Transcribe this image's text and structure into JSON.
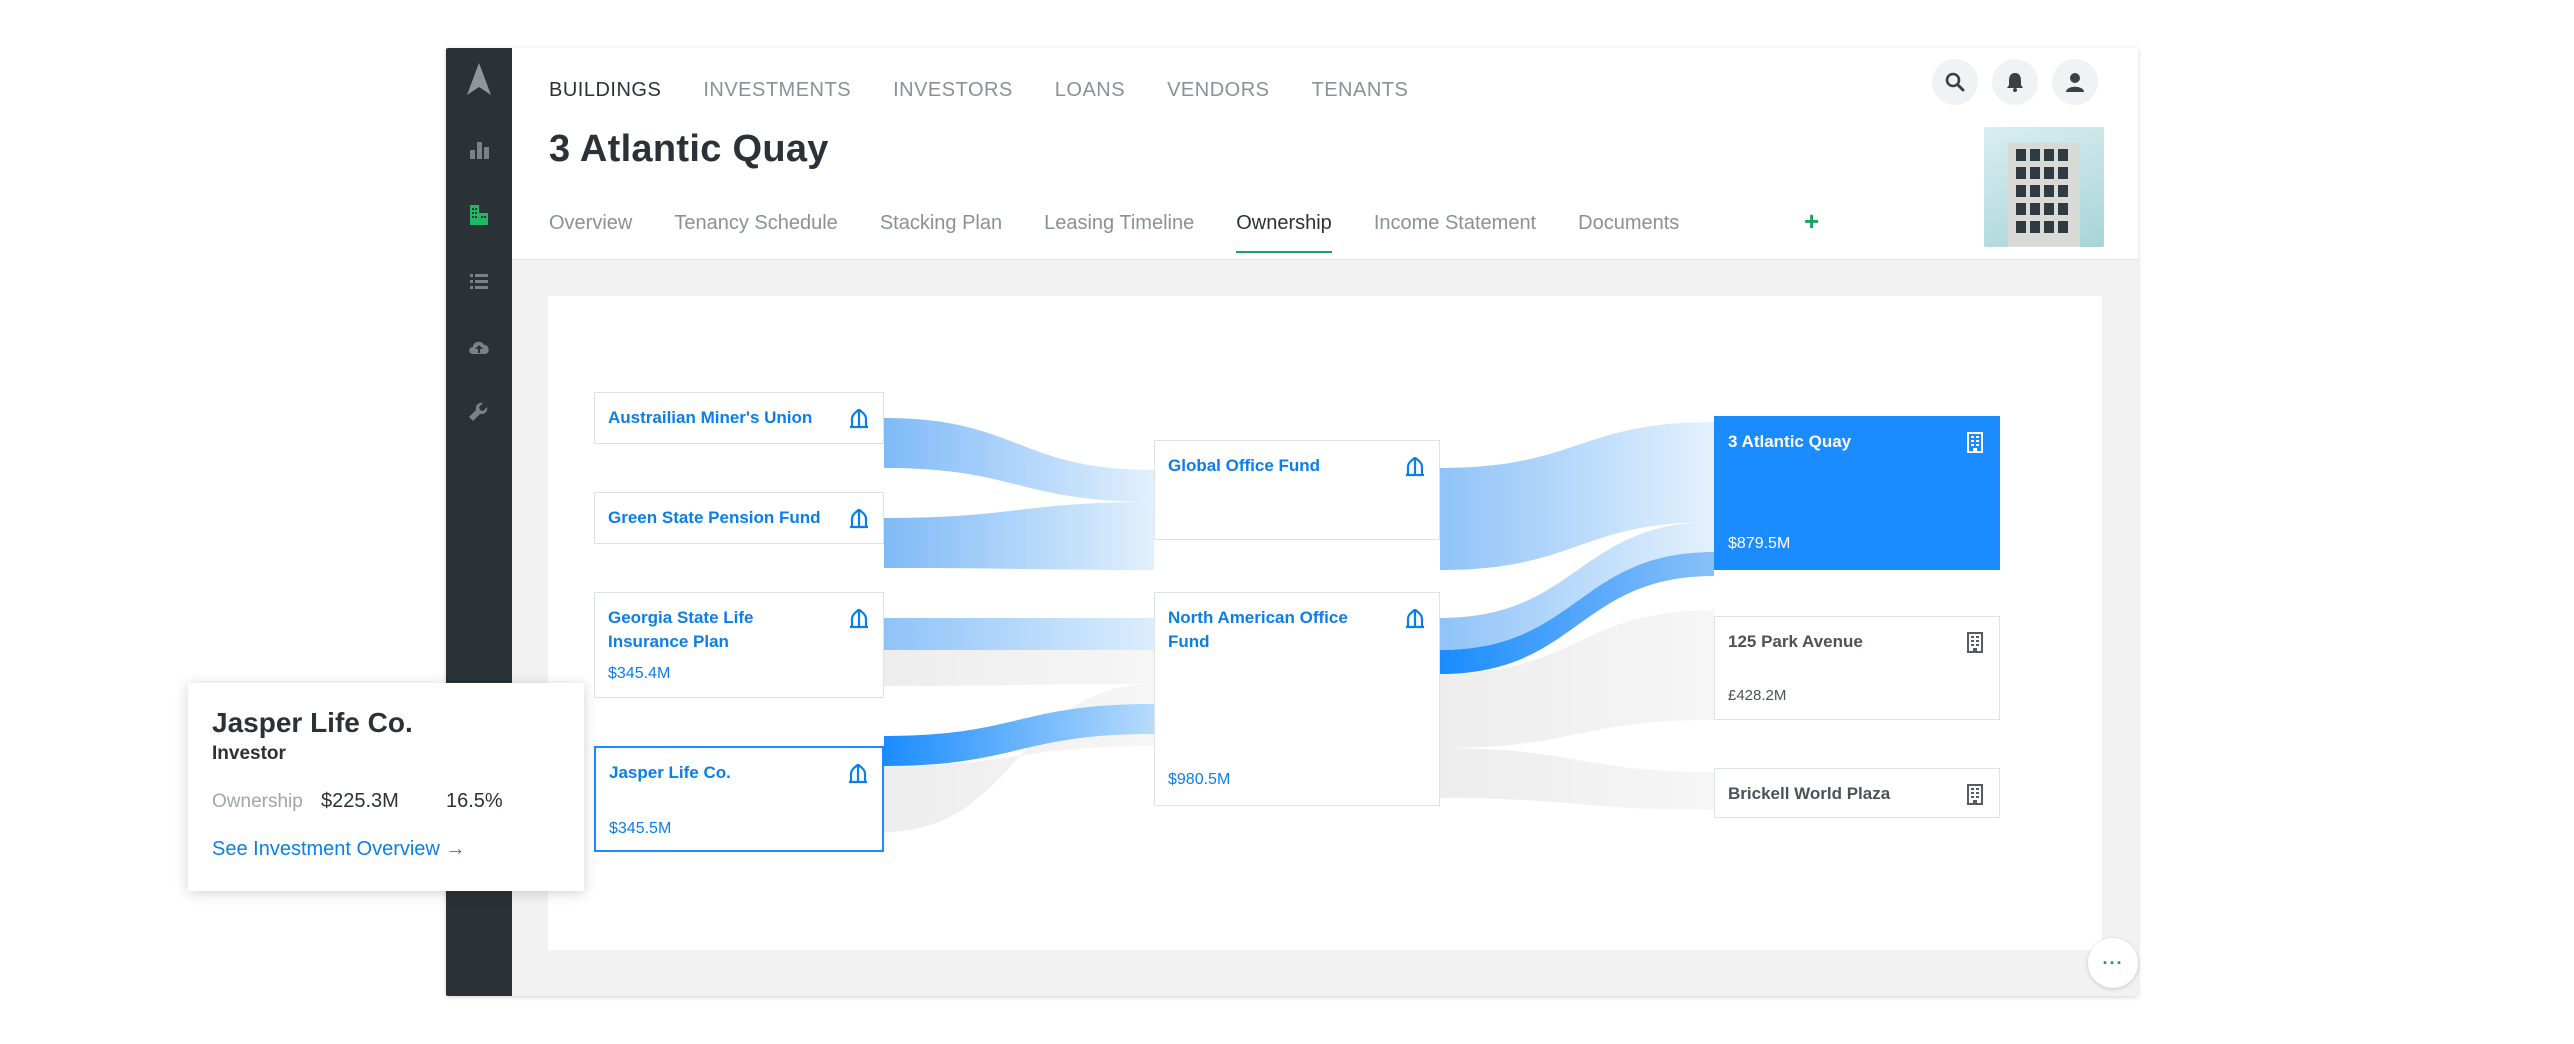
{
  "top_nav": {
    "items": [
      "BUILDINGS",
      "INVESTMENTS",
      "INVESTORS",
      "LOANS",
      "VENDORS",
      "TENANTS"
    ],
    "active": "BUILDINGS"
  },
  "page": {
    "title": "3 Atlantic Quay"
  },
  "sub_tabs": {
    "items": [
      "Overview",
      "Tenancy Schedule",
      "Stacking Plan",
      "Leasing Timeline",
      "Ownership",
      "Income Statement",
      "Documents"
    ],
    "active": "Ownership",
    "add_label": "+"
  },
  "ownership": {
    "investors": [
      {
        "name": "Austrailian Miner's Union",
        "value": ""
      },
      {
        "name": "Green State Pension Fund",
        "value": ""
      },
      {
        "name": "Georgia State Life Insurance Plan",
        "value": "$345.4M"
      },
      {
        "name": "Jasper Life Co.",
        "value": "$345.5M"
      }
    ],
    "funds": [
      {
        "name": "Global Office Fund",
        "value": ""
      },
      {
        "name": "North American Office Fund",
        "value": "$980.5M"
      }
    ],
    "buildings": [
      {
        "name": "3 Atlantic Quay",
        "value": "$879.5M"
      },
      {
        "name": "125 Park Avenue",
        "value": "£428.2M"
      },
      {
        "name": "Brickell World Plaza",
        "value": ""
      }
    ]
  },
  "popup": {
    "title": "Jasper Life Co.",
    "subtitle": "Investor",
    "ownership_label": "Ownership",
    "ownership_amount": "$225.3M",
    "ownership_pct": "16.5%",
    "link": "See Investment Overview →"
  },
  "more_button": "···",
  "colors": {
    "sidebar": "#2b3237",
    "accent_green": "#17a55b",
    "accent_blue": "#1a8cff",
    "link_blue": "#0a7fe8"
  }
}
